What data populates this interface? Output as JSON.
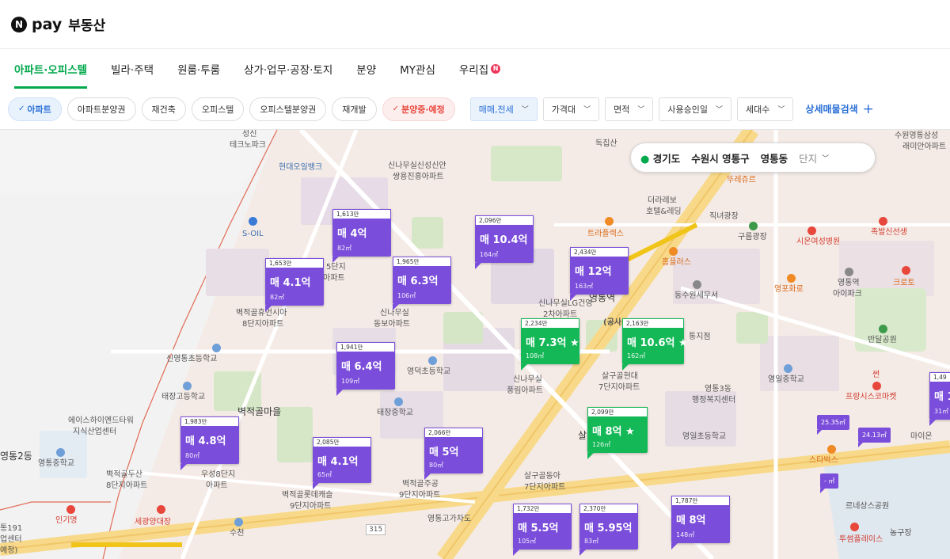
{
  "header": {
    "logo_n": "N",
    "logo_pay": "pay",
    "title": "부동산"
  },
  "nav": {
    "tabs": [
      {
        "label": "아파트·오피스텔"
      },
      {
        "label": "빌라·주택"
      },
      {
        "label": "원룸·투룸"
      },
      {
        "label": "상가·업무·공장·토지"
      },
      {
        "label": "분양"
      },
      {
        "label": "MY관심"
      },
      {
        "label": "우리집"
      }
    ],
    "new_badge": "N"
  },
  "filters": {
    "chips": [
      {
        "label": "아파트",
        "check": "✓"
      },
      {
        "label": "아파트분양권"
      },
      {
        "label": "재건축"
      },
      {
        "label": "오피스텔"
      },
      {
        "label": "오피스텔분양권"
      },
      {
        "label": "재개발"
      },
      {
        "label": "분양중·예정",
        "check": "✓"
      }
    ],
    "selects": [
      {
        "label": "매매,전세"
      },
      {
        "label": "가격대"
      },
      {
        "label": "면적"
      },
      {
        "label": "사용승인일"
      },
      {
        "label": "세대수"
      }
    ],
    "detail_search": "상세매물검색",
    "plus": "+"
  },
  "location": {
    "province": "경기도",
    "city": "수원시 영통구",
    "dong": "영통동",
    "complex": "단지"
  },
  "markers": [
    {
      "top": "1,613만",
      "price": "매 4억",
      "area": "82㎡",
      "green": false
    },
    {
      "top": "2,096만",
      "price": "매 10.4억",
      "area": "164㎡",
      "green": false
    },
    {
      "top": "2,434만",
      "price": "매 12억",
      "area": "163㎡",
      "green": false
    },
    {
      "top": "1,653만",
      "price": "매 4.1억",
      "area": "82㎡",
      "green": false
    },
    {
      "top": "1,965만",
      "price": "매 6.3억",
      "area": "106㎡",
      "green": false
    },
    {
      "top": "2,234만",
      "price": "매 7.3억 ★",
      "area": "108㎡",
      "green": true
    },
    {
      "top": "2,163만",
      "price": "매 10.6억 ★",
      "area": "162㎡",
      "green": true
    },
    {
      "top": "1,941만",
      "price": "매 6.4억",
      "area": "109㎡",
      "green": false
    },
    {
      "top": "1,983만",
      "price": "매 4.8억",
      "area": "80㎡",
      "green": false
    },
    {
      "top": "2,085만",
      "price": "매 4.1억",
      "area": "65㎡",
      "green": false
    },
    {
      "top": "2,066만",
      "price": "매 5억",
      "area": "80㎡",
      "green": false
    },
    {
      "top": "2,099만",
      "price": "매 8억 ★",
      "area": "126㎡",
      "green": true
    },
    {
      "top": "1,732만",
      "price": "매 5.5억",
      "area": "105㎡",
      "green": false
    },
    {
      "top": "2,370만",
      "price": "매 5.95억",
      "area": "83㎡",
      "green": false
    },
    {
      "top": "1,787만",
      "price": "매 8억",
      "area": "148㎡",
      "green": false
    },
    {
      "top": "1,49",
      "price": "매 1",
      "area": "31㎡",
      "green": false
    }
  ],
  "small_markers": [
    "25.35㎡",
    "24.13㎡",
    "- ㎡"
  ],
  "map_labels": {
    "seongsin": "성신",
    "tekno": "테크노파크",
    "hyundai_oil": "현대오일뱅크",
    "soil": "S-OIL",
    "sinnamu_top": "신나무실신성신안",
    "ssangyong": "쌍용진흥아파트",
    "dongjisan": "독집산",
    "suwon_samsung": "수원영통삼성",
    "raemian": "래미안아파트",
    "ttureju": "뚜레쥬르",
    "theraebo": "더라레보",
    "hotel": "호텔&레딩",
    "jiknyeo": "직녀광장",
    "trailers": "트라플렉스",
    "gureung": "구름광장",
    "sion": "시온여성병원",
    "jokbal": "족발신선생",
    "homplus": "홈플러스",
    "yeongtong_stn": "영통역",
    "gonsa": "(공사",
    "dongsuwon": "동수원세무서",
    "yeongpo": "영포화로",
    "yeongtong_apt": "영통역",
    "apt_park": "아이파크",
    "crotto": "크로토",
    "banda": "반달공원",
    "sinnamu_lg": "신나무실LG건영",
    "chada": "2차아파트",
    "jijeom": "통지점",
    "byeokjeok_shinan": "벽적골휴먼시아",
    "danji8": "8단지아파트",
    "danji5": "5단지",
    "apt5": "아파트",
    "sinnamu_dongbo": "신나무실",
    "dongbo": "동보아파트",
    "sinyeong": "신영통초등학교",
    "yeongdeok": "영덕초등학교",
    "taejang": "태장고등학교",
    "sinnamu_pungrim": "신나무실",
    "pungrim": "풍림아파트",
    "salgu_hyundai": "살구골현대",
    "danji7": "7단지아파트",
    "yeongtong3": "영통3동",
    "haengjeong": "행정복지센터",
    "yeongil": "영일중학교",
    "france": "프랑시스코마켓",
    "seon": "썬",
    "byeokjeok_village": "벽적골마을",
    "taejang_mid": "태장중학교",
    "esha": "에이스하이엔드타워",
    "jisik": "지식산업센터",
    "yeongtong_mid": "영통중학교",
    "yeongtong2": "영통2동",
    "byeokjeok_dusan": "벽적골두산",
    "danji8b": "8단지아파트",
    "useong": "우성8단지",
    "apt_u": "아파트",
    "byeokjeok_lotte": "벽적골롯데캐슬",
    "danji9": "9단지아파트",
    "byeokjeok_jugong": "벽적골주공",
    "danji9b": "9단지아파트",
    "salgu_dong": "살구골동아",
    "danji7b": "7단지아파트",
    "yeongil_elem": "영일초등학교",
    "starbucks": "스타벅스",
    "maino": "마이온",
    "ingimyeong": "인기명",
    "seagwang": "세광양대장",
    "sucheon": "수천",
    "yeongtong_overpass": "영통고가차도",
    "route": "315",
    "rene": "르네상스공원",
    "nongujang": "농구장",
    "twobum": "투썸플레이스",
    "sal": "살",
    "n191": "통191",
    "center": "업센터",
    "yeseong": "예정)"
  }
}
